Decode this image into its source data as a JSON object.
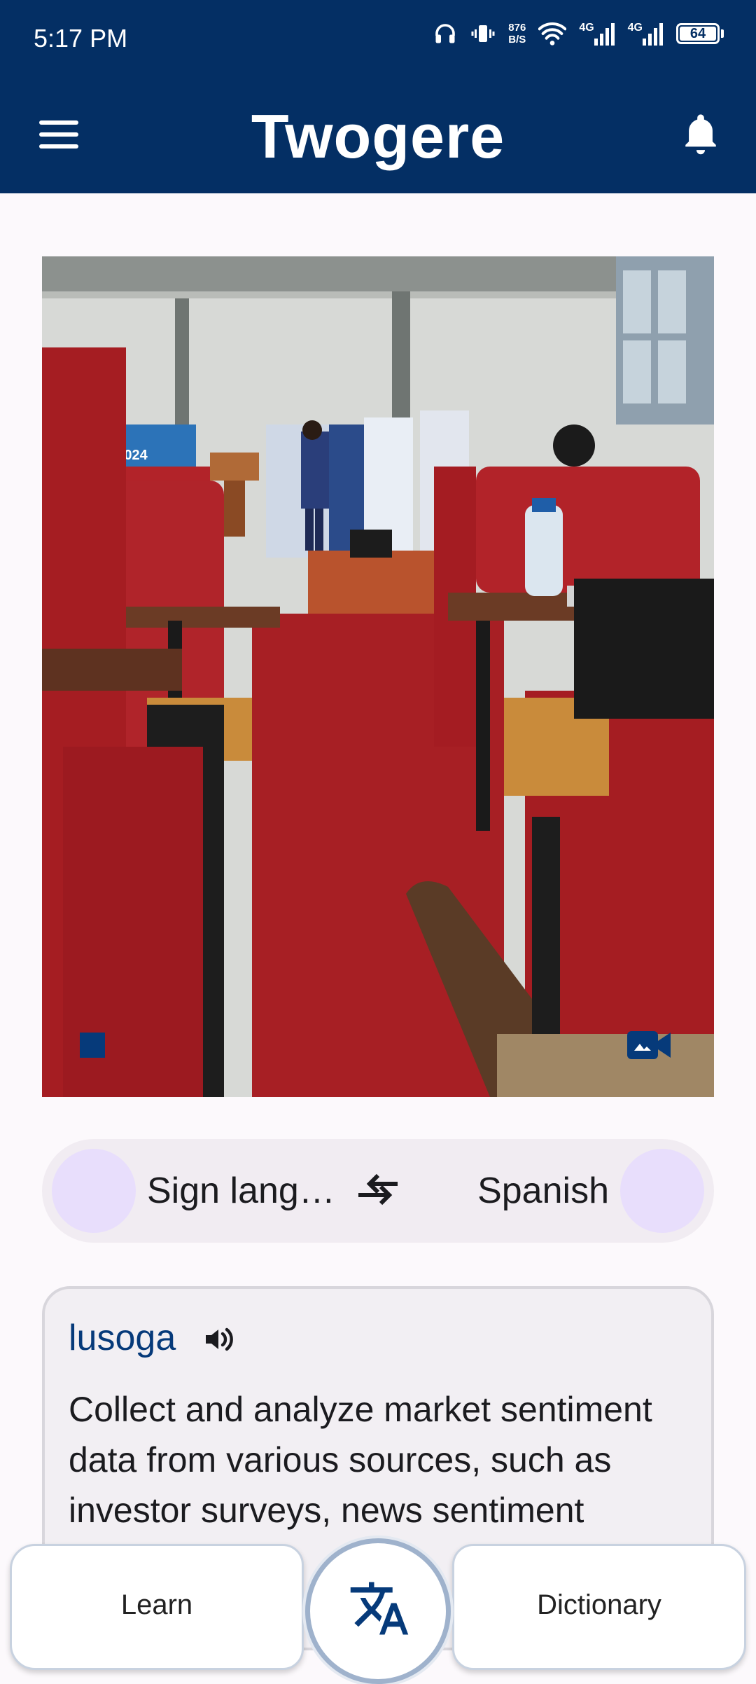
{
  "status_bar": {
    "time": "5:17 PM",
    "net_speed_value": "876",
    "net_speed_unit": "B/S",
    "signal_1": "4G",
    "signal_2": "4G",
    "battery": "64"
  },
  "app_bar": {
    "title": "Twogere",
    "menu_icon": "menu-icon",
    "notification_icon": "bell-icon"
  },
  "camera": {
    "record_icon": "stop-square-icon",
    "switch_icon": "switch-camera-icon",
    "poster_text": "I-TECH\nTHON 2024"
  },
  "language_selector": {
    "source": "Sign langa…",
    "target": "Spanish",
    "swap_icon": "swap-arrows-icon"
  },
  "result": {
    "language": "lusoga",
    "text": "Collect and analyze market sentiment data from various sources, such as investor surveys, news sentiment",
    "speaker_icon": "volume-icon"
  },
  "bottom_nav": {
    "learn_label": "Learn",
    "dictionary_label": "Dictionary",
    "center_icon": "translate-icon"
  },
  "colors": {
    "primary": "#042f64",
    "accent": "#063a7a",
    "avatar": "#e8defc",
    "background": "#fcf9fc"
  }
}
